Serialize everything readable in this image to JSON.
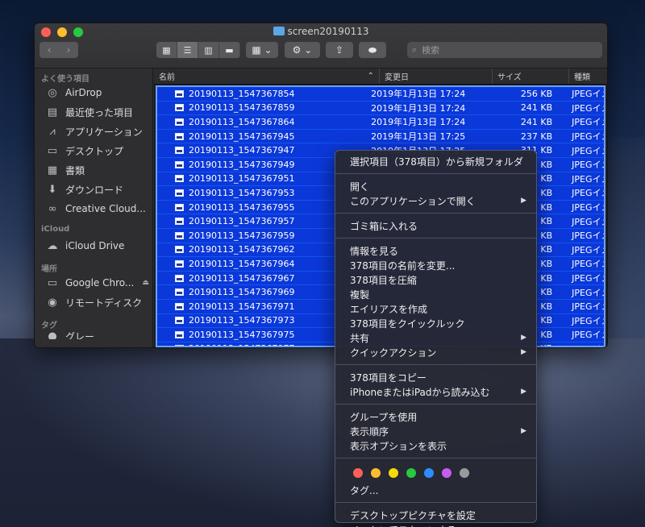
{
  "window": {
    "title": "screen20190113",
    "search_placeholder": "検索",
    "nav_back": "‹",
    "nav_forward": "›"
  },
  "sidebar": {
    "favorites_header": "よく使う項目",
    "favorites": [
      {
        "label": "AirDrop",
        "icon": "airdrop-icon"
      },
      {
        "label": "最近使った項目",
        "icon": "recents-icon"
      },
      {
        "label": "アプリケーション",
        "icon": "applications-icon"
      },
      {
        "label": "デスクトップ",
        "icon": "desktop-icon"
      },
      {
        "label": "書類",
        "icon": "documents-icon"
      },
      {
        "label": "ダウンロード",
        "icon": "downloads-icon"
      },
      {
        "label": "Creative Cloud...",
        "icon": "creative-cloud-icon"
      }
    ],
    "icloud_header": "iCloud",
    "icloud": [
      {
        "label": "iCloud Drive",
        "icon": "cloud-icon"
      }
    ],
    "locations_header": "場所",
    "locations": [
      {
        "label": "Google Chro...",
        "icon": "disk-icon"
      },
      {
        "label": "リモートディスク",
        "icon": "remote-disc-icon"
      }
    ],
    "tags_header": "タグ",
    "tags": [
      {
        "label": "グレー"
      }
    ]
  },
  "columns": {
    "name": "名前",
    "modified": "変更日",
    "size": "サイズ",
    "kind": "種類"
  },
  "files": [
    {
      "name": "20190113_1547367854",
      "date": "2019年1月13日 17:24",
      "size": "256 KB",
      "kind": "JPEGイメージ"
    },
    {
      "name": "20190113_1547367859",
      "date": "2019年1月13日 17:24",
      "size": "241 KB",
      "kind": "JPEGイメージ"
    },
    {
      "name": "20190113_1547367864",
      "date": "2019年1月13日 17:24",
      "size": "241 KB",
      "kind": "JPEGイメージ"
    },
    {
      "name": "20190113_1547367945",
      "date": "2019年1月13日 17:25",
      "size": "237 KB",
      "kind": "JPEGイメージ"
    },
    {
      "name": "20190113_1547367947",
      "date": "2019年1月13日 17:25",
      "size": "311 KB",
      "kind": "JPEGイメージ"
    },
    {
      "name": "20190113_1547367949",
      "date": "",
      "size": "KB",
      "kind": "JPEGイメージ"
    },
    {
      "name": "20190113_1547367951",
      "date": "",
      "size": "KB",
      "kind": "JPEGイメージ"
    },
    {
      "name": "20190113_1547367953",
      "date": "",
      "size": "KB",
      "kind": "JPEGイメージ"
    },
    {
      "name": "20190113_1547367955",
      "date": "",
      "size": "KB",
      "kind": "JPEGイメージ"
    },
    {
      "name": "20190113_1547367957",
      "date": "",
      "size": "KB",
      "kind": "JPEGイメージ"
    },
    {
      "name": "20190113_1547367959",
      "date": "",
      "size": "KB",
      "kind": "JPEGイメージ"
    },
    {
      "name": "20190113_1547367962",
      "date": "",
      "size": "KB",
      "kind": "JPEGイメージ"
    },
    {
      "name": "20190113_1547367964",
      "date": "",
      "size": "KB",
      "kind": "JPEGイメージ"
    },
    {
      "name": "20190113_1547367967",
      "date": "",
      "size": "KB",
      "kind": "JPEGイメージ"
    },
    {
      "name": "20190113_1547367969",
      "date": "",
      "size": "KB",
      "kind": "JPEGイメージ"
    },
    {
      "name": "20190113_1547367971",
      "date": "",
      "size": "KB",
      "kind": "JPEGイメージ"
    },
    {
      "name": "20190113_1547367973",
      "date": "",
      "size": "KB",
      "kind": "JPEGイメージ"
    },
    {
      "name": "20190113_1547367975",
      "date": "",
      "size": "KB",
      "kind": "JPEGイメージ"
    },
    {
      "name": "20190113_1547367977",
      "date": "",
      "size": "KB",
      "kind": "JPEGイメージ"
    }
  ],
  "context_menu": {
    "groups": [
      [
        {
          "label": "選択項目（378項目）から新規フォルダ"
        }
      ],
      [
        {
          "label": "開く"
        },
        {
          "label": "このアプリケーションで開く",
          "submenu": true
        }
      ],
      [
        {
          "label": "ゴミ箱に入れる"
        }
      ],
      [
        {
          "label": "情報を見る"
        },
        {
          "label": "378項目の名前を変更..."
        },
        {
          "label": "378項目を圧縮"
        },
        {
          "label": "複製"
        },
        {
          "label": "エイリアスを作成"
        },
        {
          "label": "378項目をクイックルック"
        },
        {
          "label": "共有",
          "submenu": true
        },
        {
          "label": "クイックアクション",
          "submenu": true
        }
      ],
      [
        {
          "label": "378項目をコピー"
        },
        {
          "label": "iPhoneまたはiPadから読み込む",
          "submenu": true
        }
      ],
      [
        {
          "label": "グループを使用"
        },
        {
          "label": "表示順序",
          "submenu": true
        },
        {
          "label": "表示オプションを表示"
        }
      ],
      "TAGS",
      [
        {
          "label": "デスクトップピクチャを設定"
        },
        {
          "label": "ノートンでスキャンする"
        }
      ]
    ],
    "tag_colors": [
      "#fe5f57",
      "#febc2e",
      "#f5d90a",
      "#28c840",
      "#2f8cff",
      "#c85cf0",
      "#9a9a9a"
    ],
    "tags_label": "タグ..."
  }
}
